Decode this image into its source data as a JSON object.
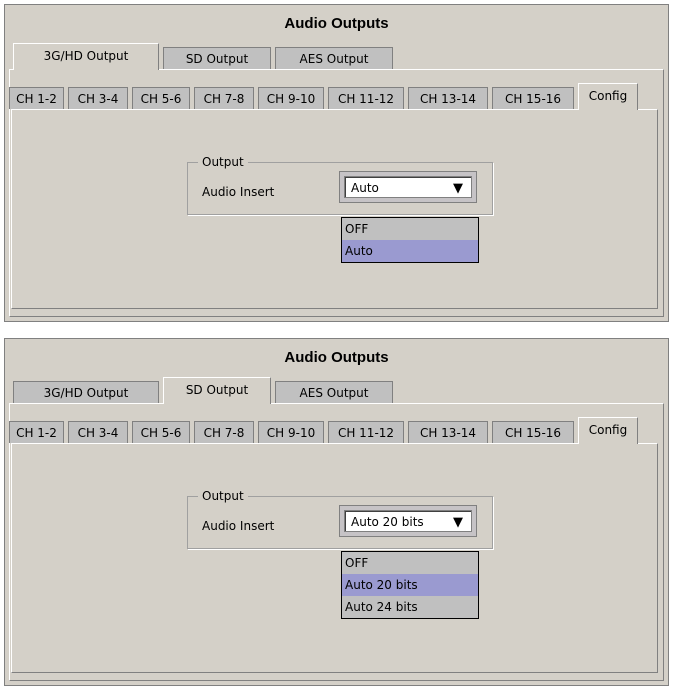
{
  "colors": {
    "panel_bg": "#d4d0c8",
    "selected_option_bg": "#9a9ad0"
  },
  "panels": [
    {
      "title": "Audio Outputs",
      "outer_tabs": [
        {
          "label": "3G/HD Output",
          "active": true
        },
        {
          "label": "SD Output",
          "active": false
        },
        {
          "label": "AES Output",
          "active": false
        }
      ],
      "inner_tabs": [
        {
          "label": "CH 1-2"
        },
        {
          "label": "CH 3-4"
        },
        {
          "label": "CH 5-6"
        },
        {
          "label": "CH 7-8"
        },
        {
          "label": "CH 9-10"
        },
        {
          "label": "CH 11-12"
        },
        {
          "label": "CH 13-14"
        },
        {
          "label": "CH 15-16"
        },
        {
          "label": "Config",
          "active": true
        }
      ],
      "group_title": "Output",
      "field_label": "Audio Insert",
      "selected_value": "Auto",
      "options": [
        {
          "label": "OFF",
          "selected": false
        },
        {
          "label": "Auto",
          "selected": true
        }
      ]
    },
    {
      "title": "Audio Outputs",
      "outer_tabs": [
        {
          "label": "3G/HD Output",
          "active": false
        },
        {
          "label": "SD Output",
          "active": true
        },
        {
          "label": "AES Output",
          "active": false
        }
      ],
      "inner_tabs": [
        {
          "label": "CH 1-2"
        },
        {
          "label": "CH 3-4"
        },
        {
          "label": "CH 5-6"
        },
        {
          "label": "CH 7-8"
        },
        {
          "label": "CH 9-10"
        },
        {
          "label": "CH 11-12"
        },
        {
          "label": "CH 13-14"
        },
        {
          "label": "CH 15-16"
        },
        {
          "label": "Config",
          "active": true
        }
      ],
      "group_title": "Output",
      "field_label": "Audio Insert",
      "selected_value": "Auto 20 bits",
      "options": [
        {
          "label": "OFF",
          "selected": false
        },
        {
          "label": "Auto 20 bits",
          "selected": true
        },
        {
          "label": "Auto 24 bits",
          "selected": false
        }
      ]
    }
  ]
}
